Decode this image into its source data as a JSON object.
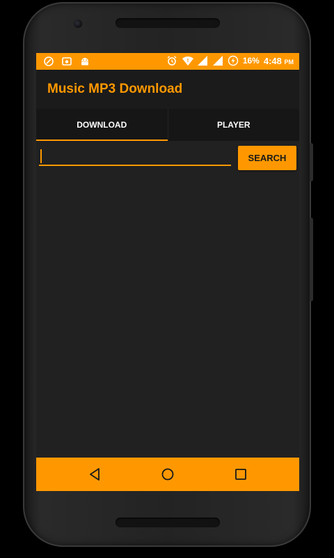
{
  "status_bar": {
    "battery": "16%",
    "time": "4:48",
    "time_suffix": "PM",
    "left_icons": [
      "sync-icon",
      "photo-icon",
      "android-icon"
    ],
    "right_icons": [
      "alarm-icon",
      "wifi-icon",
      "signal-icon",
      "signal-icon",
      "battery-charging-icon"
    ]
  },
  "app_bar": {
    "title": "Music MP3 Download"
  },
  "tabs": [
    {
      "label": "DOWNLOAD",
      "active": true
    },
    {
      "label": "PLAYER",
      "active": false
    }
  ],
  "search": {
    "value": "",
    "placeholder": "",
    "button_label": "SEARCH"
  },
  "nav_bar": {
    "icons": [
      "back-icon",
      "home-icon",
      "recents-icon"
    ]
  },
  "colors": {
    "accent": "#ff9800",
    "background": "#212121",
    "app_bar": "#1b1b1b",
    "tab_bar": "#161616",
    "text": "#ffffff"
  }
}
